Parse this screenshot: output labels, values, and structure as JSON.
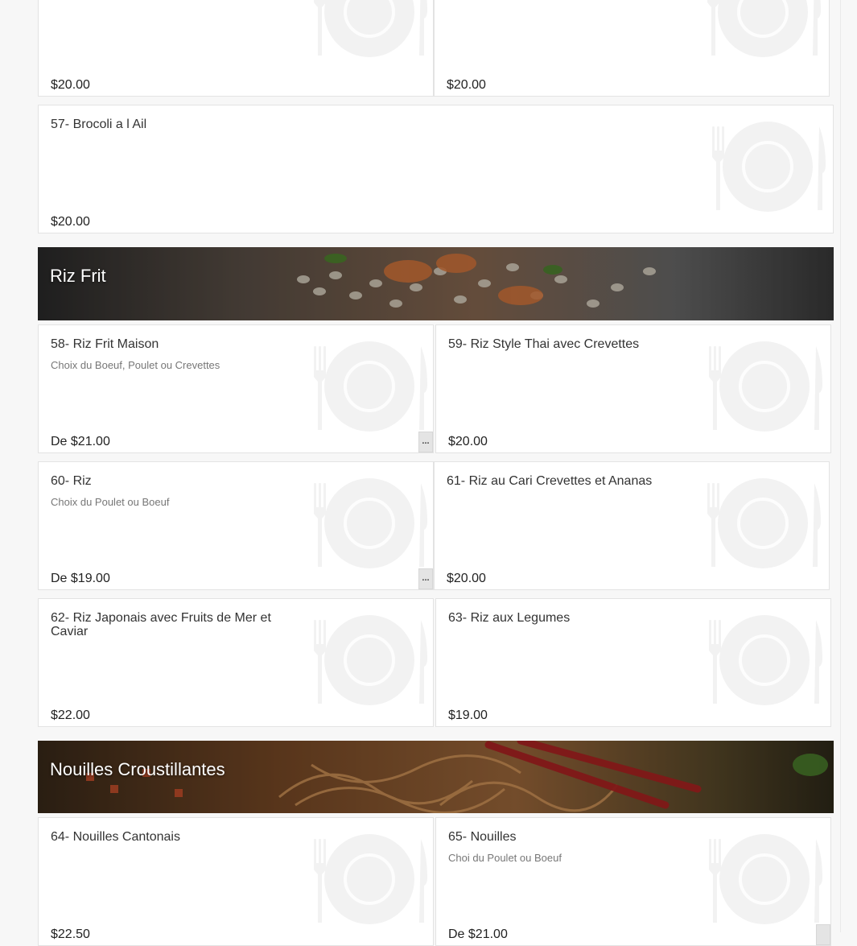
{
  "icons": {
    "placeholder": "plate-fork-knife-icon",
    "more": "ellipsis-icon"
  },
  "colors": {
    "page_bg": "#f7f7f7",
    "card_bg": "#ffffff",
    "card_border": "#e3e3e3",
    "banner_text": "#ffffff"
  },
  "top": {
    "left_price": "$20.00",
    "right_price": "$20.00"
  },
  "item57": {
    "name": "57- Brocoli a l Ail",
    "price": "$20.00"
  },
  "riz_frit": {
    "title": "Riz Frit",
    "items": [
      {
        "name": "58- Riz Frit Maison",
        "desc": "Choix du Boeuf, Poulet ou Crevettes",
        "price": "De $21.00",
        "more": "..."
      },
      {
        "name": "59- Riz Style Thai avec Crevettes",
        "price": "$20.00"
      },
      {
        "name": "60- Riz",
        "desc": "Choix du Poulet ou Boeuf",
        "price": "De $19.00",
        "more": "..."
      },
      {
        "name": "61- Riz au Cari Crevettes et Ananas",
        "price": "$20.00"
      },
      {
        "name": "62- Riz Japonais avec Fruits de Mer et Caviar",
        "price": "$22.00"
      },
      {
        "name": "63- Riz aux Legumes",
        "price": "$19.00"
      }
    ]
  },
  "nouilles": {
    "title": "Nouilles Croustillantes",
    "items": [
      {
        "name": "64- Nouilles Cantonais",
        "price": "$22.50"
      },
      {
        "name": "65- Nouilles",
        "desc": "Choi du Poulet ou Boeuf",
        "price": "De $21.00"
      }
    ]
  }
}
